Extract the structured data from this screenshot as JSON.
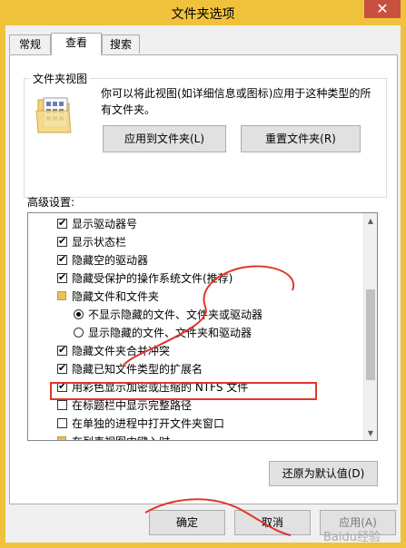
{
  "window": {
    "title": "文件夹选项",
    "close_glyph": "✕"
  },
  "tabs": [
    {
      "label": "常规",
      "active": false
    },
    {
      "label": "查看",
      "active": true
    },
    {
      "label": "搜索",
      "active": false
    }
  ],
  "folder_views": {
    "group_label": "文件夹视图",
    "description": "你可以将此视图(如详细信息或图标)应用于这种类型的所有文件夹。",
    "apply_button": "应用到文件夹(L)",
    "reset_button": "重置文件夹(R)"
  },
  "advanced": {
    "label": "高级设置:",
    "items": [
      {
        "kind": "checkbox",
        "checked": true,
        "indent": 0,
        "label": "显示驱动器号"
      },
      {
        "kind": "checkbox",
        "checked": true,
        "indent": 0,
        "label": "显示状态栏"
      },
      {
        "kind": "checkbox",
        "checked": true,
        "indent": 0,
        "label": "隐藏空的驱动器"
      },
      {
        "kind": "checkbox",
        "checked": true,
        "indent": 0,
        "label": "隐藏受保护的操作系统文件(推荐)"
      },
      {
        "kind": "folder",
        "checked": false,
        "indent": 0,
        "label": "隐藏文件和文件夹"
      },
      {
        "kind": "radio",
        "checked": true,
        "indent": 1,
        "label": "不显示隐藏的文件、文件夹或驱动器"
      },
      {
        "kind": "radio",
        "checked": false,
        "indent": 1,
        "label": "显示隐藏的文件、文件夹和驱动器"
      },
      {
        "kind": "checkbox",
        "checked": true,
        "indent": 0,
        "label": "隐藏文件夹合并冲突"
      },
      {
        "kind": "checkbox",
        "checked": true,
        "indent": 0,
        "label": "隐藏已知文件类型的扩展名"
      },
      {
        "kind": "checkbox",
        "checked": true,
        "indent": 0,
        "label": "用彩色显示加密或压缩的 NTFS 文件"
      },
      {
        "kind": "checkbox",
        "checked": false,
        "indent": 0,
        "label": "在标题栏中显示完整路径"
      },
      {
        "kind": "checkbox",
        "checked": false,
        "indent": 0,
        "label": "在单独的进程中打开文件夹窗口"
      },
      {
        "kind": "folder",
        "checked": false,
        "indent": 0,
        "label": "在列表视图中键入时"
      }
    ],
    "restore_button": "还原为默认值(D)"
  },
  "footer": {
    "ok_button": "确定",
    "cancel_button": "取消",
    "apply_button": "应用(A)"
  },
  "watermark": "Baidu经验",
  "colors": {
    "title_bar": "#f0c23c",
    "close_button": "#c7503e",
    "highlight": "#e0362c"
  }
}
